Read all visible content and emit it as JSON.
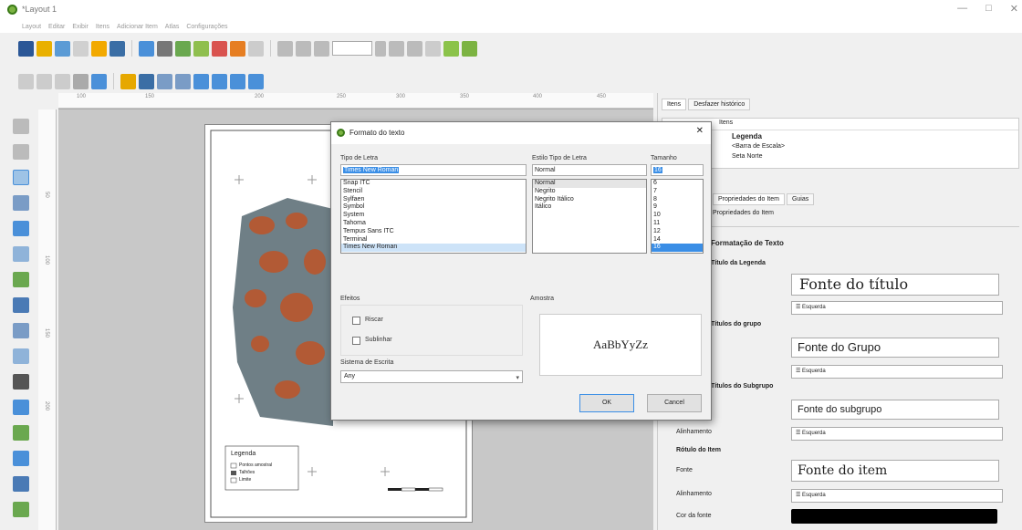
{
  "window": {
    "title": "*Layout 1"
  },
  "menu": [
    "Layout",
    "Editar",
    "Exibir",
    "Itens",
    "Adicionar Item",
    "Atlas",
    "Configurações"
  ],
  "ruler_labels_h": [
    "100",
    "150",
    "200",
    "250",
    "300",
    "350",
    "400",
    "450"
  ],
  "ruler_labels_v": [
    "50",
    "100",
    "150",
    "200"
  ],
  "dialog": {
    "title": "Formato do texto",
    "font_label": "Tipo de Letra",
    "font_value": "Times New Roman",
    "fonts": [
      "Snap ITC",
      "Stencil",
      "Sylfaen",
      "Symbol",
      "System",
      "Tahoma",
      "Tempus Sans ITC",
      "Terminal",
      "Times New Roman"
    ],
    "style_label": "Estilo Tipo de Letra",
    "style_value": "Normal",
    "styles": [
      "Normal",
      "Negrito",
      "Negrito Itálico",
      "Itálico"
    ],
    "size_label": "Tamanho",
    "size_value": "16",
    "sizes": [
      "6",
      "7",
      "8",
      "9",
      "10",
      "11",
      "12",
      "14",
      "16"
    ],
    "effects_label": "Efeitos",
    "strike_label": "Riscar",
    "underline_label": "Sublinhar",
    "writing_system_label": "Sistema de Escrita",
    "writing_system_value": "Any",
    "sample_label": "Amostra",
    "sample_text": "AaBbYyZz",
    "ok": "OK",
    "cancel": "Cancel"
  },
  "panel": {
    "tabs": [
      "Itens",
      "Desfazer histórico"
    ],
    "items_header": "Itens",
    "tree": [
      "Legenda",
      "<Barra de Escala>",
      "Seta Norte"
    ],
    "prop_tabs": [
      "Propriedades do Item",
      "Guias"
    ],
    "section": "Propriedades do Item",
    "text_format_header": "Formatação de Texto",
    "legend_title_header": "Título da Legenda",
    "title_font": "Fonte do título",
    "group_header": "Títulos do grupo",
    "group_font": "Fonte do Grupo",
    "subgroup_header": "Títulos do Subgrupo",
    "subgroup_font": "Fonte do subgrupo",
    "align_label": "Alinhamento",
    "align_value": "Esquerda",
    "item_header": "Rótulo do Item",
    "font_label": "Fonte",
    "item_font": "Fonte do item",
    "color_label": "Cor da fonte",
    "color_value": "#000000"
  },
  "map": {
    "legend_title": "Legenda",
    "legend_items": [
      "Pontos amostral",
      "Talhões",
      "Limite"
    ]
  }
}
